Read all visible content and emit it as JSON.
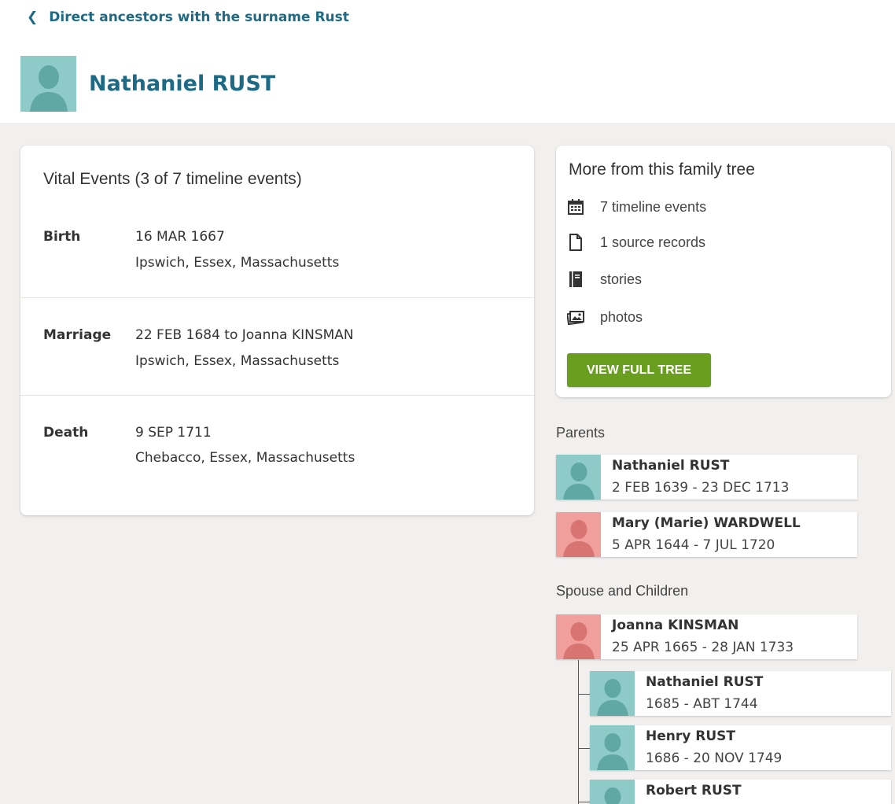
{
  "nav": {
    "back_label": "Direct ancestors with the surname Rust"
  },
  "person": {
    "name": "Nathaniel RUST"
  },
  "vital": {
    "title": "Vital Events (3 of 7 timeline events)",
    "events": [
      {
        "label": "Birth",
        "line1": "16 MAR 1667",
        "line2": "Ipswich, Essex, Massachusetts"
      },
      {
        "label": "Marriage",
        "line1": "22 FEB 1684 to Joanna KINSMAN",
        "line2": "Ipswich, Essex, Massachusetts"
      },
      {
        "label": "Death",
        "line1": "9 SEP 1711",
        "line2": "Chebacco, Essex, Massachusetts"
      }
    ]
  },
  "more": {
    "title": "More from this family tree",
    "items": [
      {
        "icon": "calendar-icon",
        "label": "7 timeline events"
      },
      {
        "icon": "document-icon",
        "label": "1 source records"
      },
      {
        "icon": "book-icon",
        "label": "stories"
      },
      {
        "icon": "photos-icon",
        "label": "photos"
      }
    ],
    "button_label": "VIEW FULL TREE"
  },
  "parents": {
    "label": "Parents",
    "people": [
      {
        "name": "Nathaniel RUST",
        "dates": "2 FEB 1639 - 23 DEC 1713",
        "gender": "male"
      },
      {
        "name": "Mary (Marie) WARDWELL",
        "dates": "5 APR 1644 - 7 JUL 1720",
        "gender": "female"
      }
    ]
  },
  "spouse_children": {
    "label": "Spouse and Children",
    "spouse": {
      "name": "Joanna KINSMAN",
      "dates": "25 APR 1665 - 28 JAN 1733",
      "gender": "female"
    },
    "children": [
      {
        "name": "Nathaniel RUST",
        "dates": "1685 - ABT 1744",
        "gender": "male"
      },
      {
        "name": "Henry RUST",
        "dates": "1686 - 20 NOV 1749",
        "gender": "male"
      },
      {
        "name": "Robert RUST",
        "dates": "",
        "gender": "male"
      }
    ]
  },
  "colors": {
    "link": "#1e6a84",
    "button_green": "#6a9e1f",
    "male_avatar": "#8ecbc8",
    "female_avatar": "#f09f9d",
    "page_bg": "#f1f0ee"
  }
}
